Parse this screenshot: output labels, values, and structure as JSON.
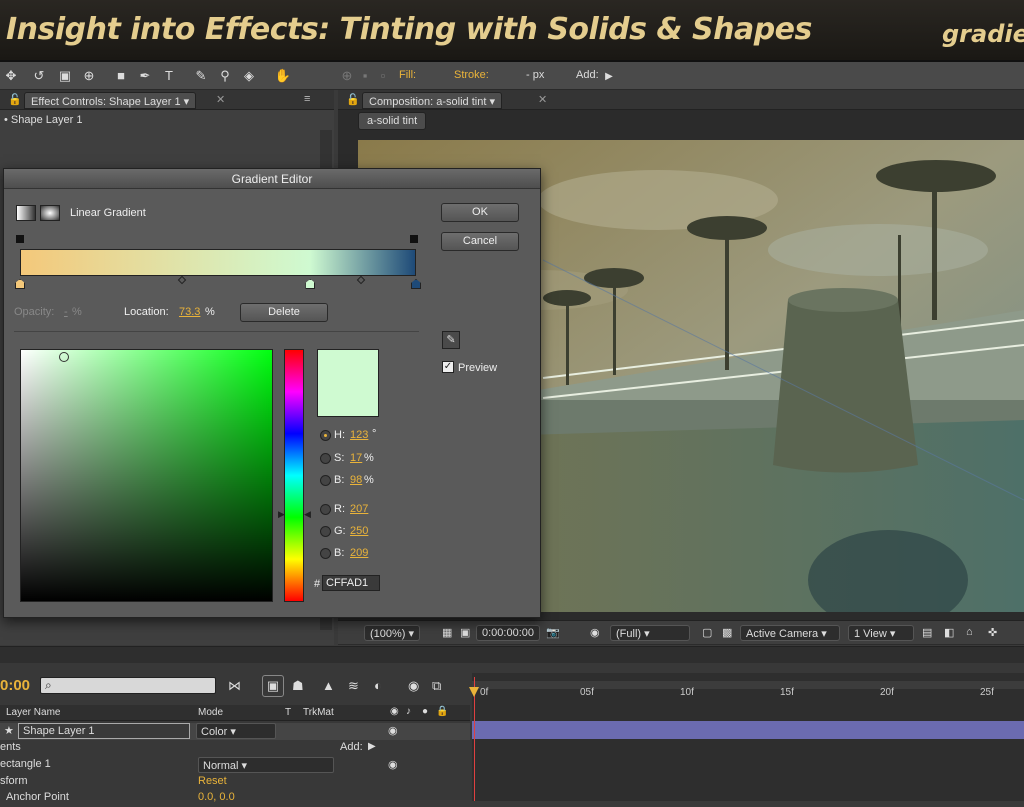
{
  "banner": {
    "title": "Insight into Effects: Tinting with Solids & Shapes",
    "right": "gradie"
  },
  "toolbar": {
    "fill_label": "Fill:",
    "stroke_label": "Stroke:",
    "px_label": "- px",
    "add_label": "Add:",
    "colors": {
      "fill": "#e8dcaa",
      "stroke": "#c8322a"
    }
  },
  "effect_panel": {
    "tab": "Effect Controls: Shape Layer 1",
    "layer": "• Shape Layer 1"
  },
  "comp_panel": {
    "tab": "Composition: a-solid tint",
    "subtab": "a-solid tint"
  },
  "comp_footer": {
    "zoom": "(100%)",
    "timecode": "0:00:00:00",
    "resolution": "(Full)",
    "camera": "Active Camera",
    "view": "1 View"
  },
  "gradient_editor": {
    "title": "Gradient Editor",
    "type_label": "Linear Gradient",
    "ok": "OK",
    "cancel": "Cancel",
    "delete": "Delete",
    "opacity_label": "Opacity:",
    "opacity_value": "-",
    "opacity_unit": "%",
    "location_label": "Location:",
    "location_value": "73.3",
    "location_unit": "%",
    "preview_label": "Preview",
    "hsb": {
      "h_label": "H:",
      "h": "123",
      "h_unit": "°",
      "s_label": "S:",
      "s": "17",
      "s_unit": "%",
      "b_label": "B:",
      "b": "98",
      "b_unit": "%"
    },
    "rgb": {
      "r_label": "R:",
      "r": "207",
      "g_label": "G:",
      "g": "250",
      "b_label": "B:",
      "b": "209"
    },
    "hex_label": "#",
    "hex": "CFFAD1",
    "stops": [
      {
        "color": "#f4c87a",
        "location": 0
      },
      {
        "color": "#cffad1",
        "location": 73.3
      },
      {
        "color": "#1e4a78",
        "location": 100
      }
    ],
    "swatch_color": "#cffad1"
  },
  "timeline": {
    "time": "0:00",
    "col_layer": "Layer Name",
    "col_mode": "Mode",
    "col_t": "T",
    "col_trkmat": "TrkMat",
    "rows": [
      {
        "name": "Shape Layer 1",
        "mode": "Color"
      },
      {
        "name": "ents",
        "add": "Add:"
      },
      {
        "name": "ectangle 1",
        "mode": "Normal"
      },
      {
        "name": "sform",
        "reset": "Reset"
      },
      {
        "name": "Anchor Point",
        "value": "0.0, 0.0"
      }
    ],
    "ruler": [
      "0f",
      "05f",
      "10f",
      "15f",
      "20f",
      "25f"
    ]
  }
}
